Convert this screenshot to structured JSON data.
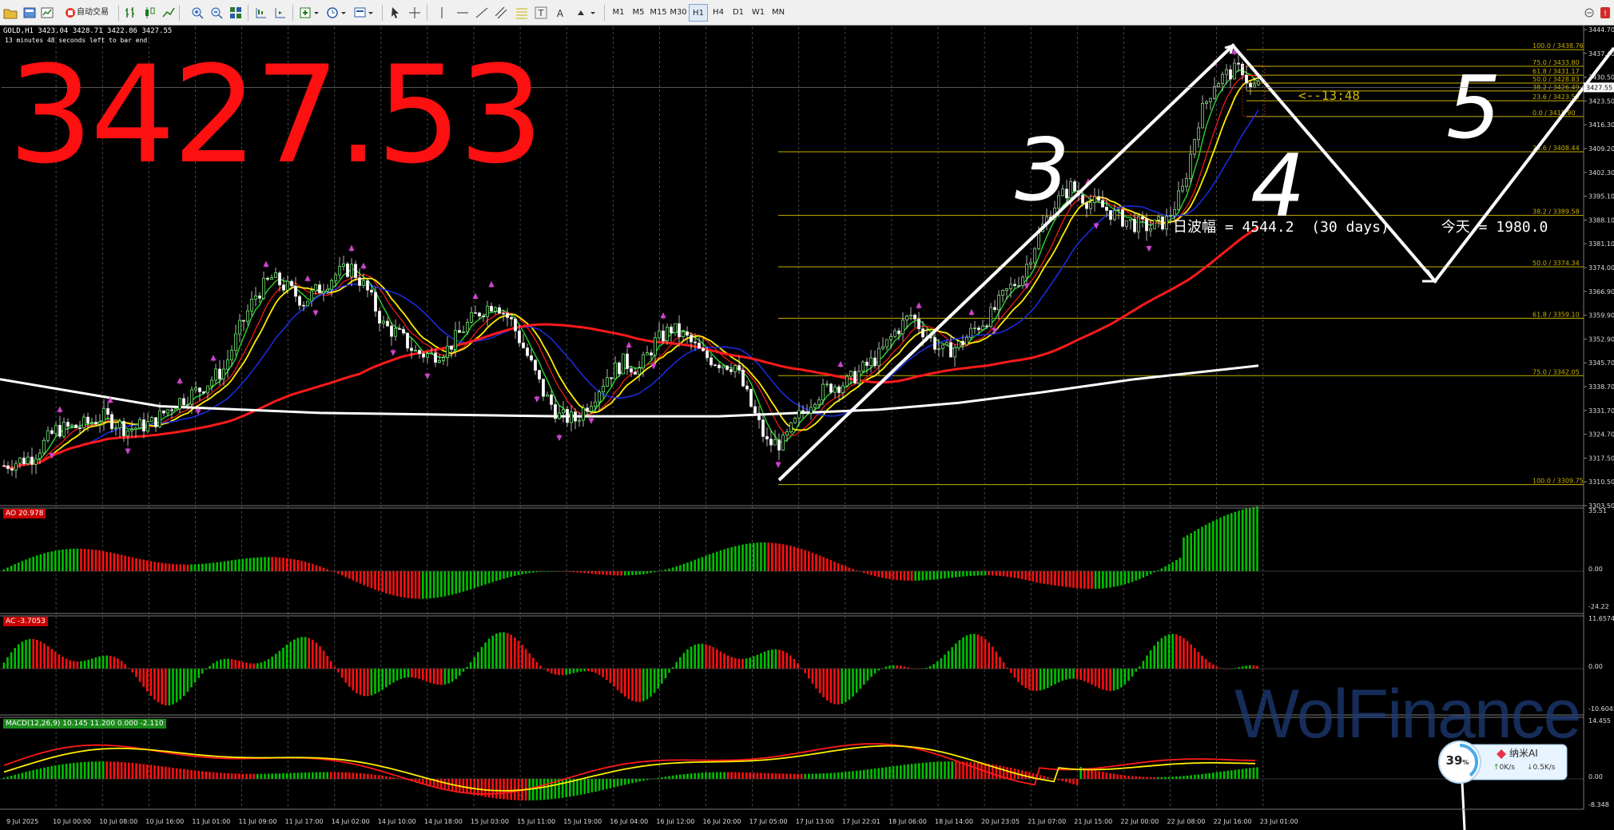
{
  "toolbar": {
    "auto_trade_label": "自动交易",
    "timeframes": [
      "M1",
      "M5",
      "M15",
      "M30",
      "H1",
      "H4",
      "D1",
      "W1",
      "MN"
    ],
    "active_timeframe": "H1"
  },
  "chart": {
    "symbol_line": "GOLD,H1  3423.04 3428.71 3422.86 3427.55",
    "timer_line": "13 minutes 48 seconds left to bar end",
    "big_price": "3427.53",
    "bar_countdown": "<--13:48",
    "range_text": "日波幅 = 4544.2  (30 days)      今天 = 1980.0",
    "wave_labels": [
      "3",
      "4",
      "5"
    ],
    "price_axis": [
      "3444.70",
      "3437.40",
      "3430.50",
      "3423.50",
      "3416.30",
      "3409.20",
      "3402.30",
      "3395.10",
      "3388.10",
      "3381.10",
      "3374.00",
      "3366.90",
      "3359.90",
      "3352.90",
      "3345.70",
      "3338.70",
      "3331.70",
      "3324.70",
      "3317.50",
      "3310.50",
      "3303.50"
    ],
    "current_price_tag": "3427.55",
    "time_axis": [
      "9 Jul 2025",
      "10 Jul 00:00",
      "10 Jul 08:00",
      "10 Jul 16:00",
      "11 Jul 01:00",
      "11 Jul 09:00",
      "11 Jul 17:00",
      "14 Jul 02:00",
      "14 Jul 10:00",
      "14 Jul 18:00",
      "15 Jul 03:00",
      "15 Jul 11:00",
      "15 Jul 19:00",
      "16 Jul 04:00",
      "16 Jul 12:00",
      "16 Jul 20:00",
      "17 Jul 05:00",
      "17 Jul 13:00",
      "17 Jul 22:01",
      "18 Jul 06:00",
      "18 Jul 14:00",
      "20 Jul 23:05",
      "21 Jul 07:00",
      "21 Jul 15:00",
      "22 Jul 00:00",
      "22 Jul 08:00",
      "22 Jul 16:00",
      "23 Jul 01:00"
    ],
    "fib_upper": [
      "100.0 / 3438.76",
      "75.0 / 3433.80",
      "61.8 / 3431.17",
      "50.0 / 3428.83",
      "38.2 / 3426.49",
      "23.6 / 3423.59",
      "0.0 / 3418.90"
    ],
    "fib_lower": [
      "23.6 / 3408.44",
      "38.2 / 3389.58",
      "50.0 / 3374.34",
      "61.8 / 3359.10",
      "75.0 / 3342.05",
      "100.0 / 3309.75"
    ]
  },
  "indicators": {
    "ao": {
      "label": "AO 20.978",
      "scale": [
        "35.51",
        "0.00",
        "-24.22"
      ]
    },
    "ac": {
      "label": "AC -3.7053",
      "scale": [
        "11.6574",
        "0.00",
        "-10.6045"
      ]
    },
    "macd": {
      "label": "MACD(12,26,9) 10.145 11.200 0.000 -2.110",
      "scale": [
        "14.455",
        "0.00",
        "-8.348"
      ]
    }
  },
  "watermark": "WolFinance",
  "ai_widget": {
    "percent": "39",
    "percent_suffix": "%",
    "name": "纳米AI",
    "down": "0K/s",
    "up": "0.5K/s"
  },
  "colors": {
    "bull": "#00c000",
    "bear": "#ff1010",
    "ma_fast": "#2bd42b",
    "ma_mid": "#ffee00",
    "ma_slow": "#1a2ee8",
    "ma_long": "#ff1a1a",
    "ma_trend": "#ffffff",
    "fib": "#c8b000"
  }
}
